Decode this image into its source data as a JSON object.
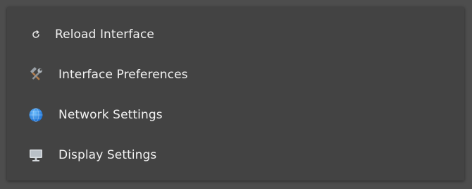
{
  "menu": {
    "items": [
      {
        "label": "Reload Interface",
        "icon": "reload-icon"
      },
      {
        "label": "Interface Preferences",
        "icon": "tools-icon"
      },
      {
        "label": "Network Settings",
        "icon": "globe-icon"
      },
      {
        "label": "Display Settings",
        "icon": "monitor-icon"
      }
    ]
  },
  "colors": {
    "background": "#4d4d4d",
    "panel": "#434343",
    "text": "#f2f2f2",
    "globe": "#2f8fe6"
  }
}
